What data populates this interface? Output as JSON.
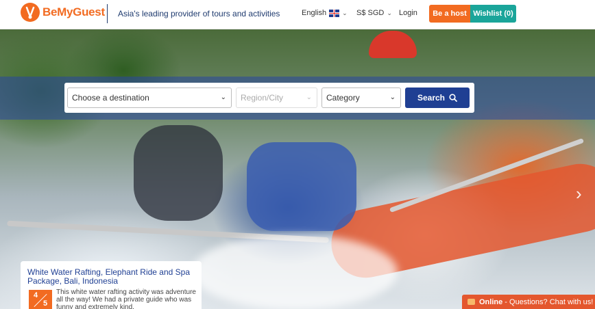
{
  "header": {
    "brand": "BeMyGuest",
    "tagline": "Asia's leading provider of tours and activities",
    "language": "English",
    "currency": "S$ SGD",
    "login": "Login",
    "host_button": "Be a host",
    "wishlist_button": "Wishlist (0)"
  },
  "search": {
    "destination_placeholder": "Choose a destination",
    "region_placeholder": "Region/City",
    "category_placeholder": "Category",
    "search_button": "Search"
  },
  "review": {
    "title": "White Water Rafting, Elephant Ride and Spa Package, Bali, Indonesia",
    "rating_value": "4",
    "rating_max": "5",
    "text": "This white water rafting activity was adventure all the way! We had a private guide who was funny and extremely kind."
  },
  "chat": {
    "status": "Online",
    "label": " - Questions? Chat with us!"
  },
  "colors": {
    "brand_orange": "#f26b21",
    "teal": "#1aa59a",
    "navy": "#1f3f93"
  },
  "icons": {
    "logo": "hands-logo-icon",
    "search": "search-icon",
    "next": "chevron-right-icon",
    "chat": "chat-bubble-icon"
  }
}
